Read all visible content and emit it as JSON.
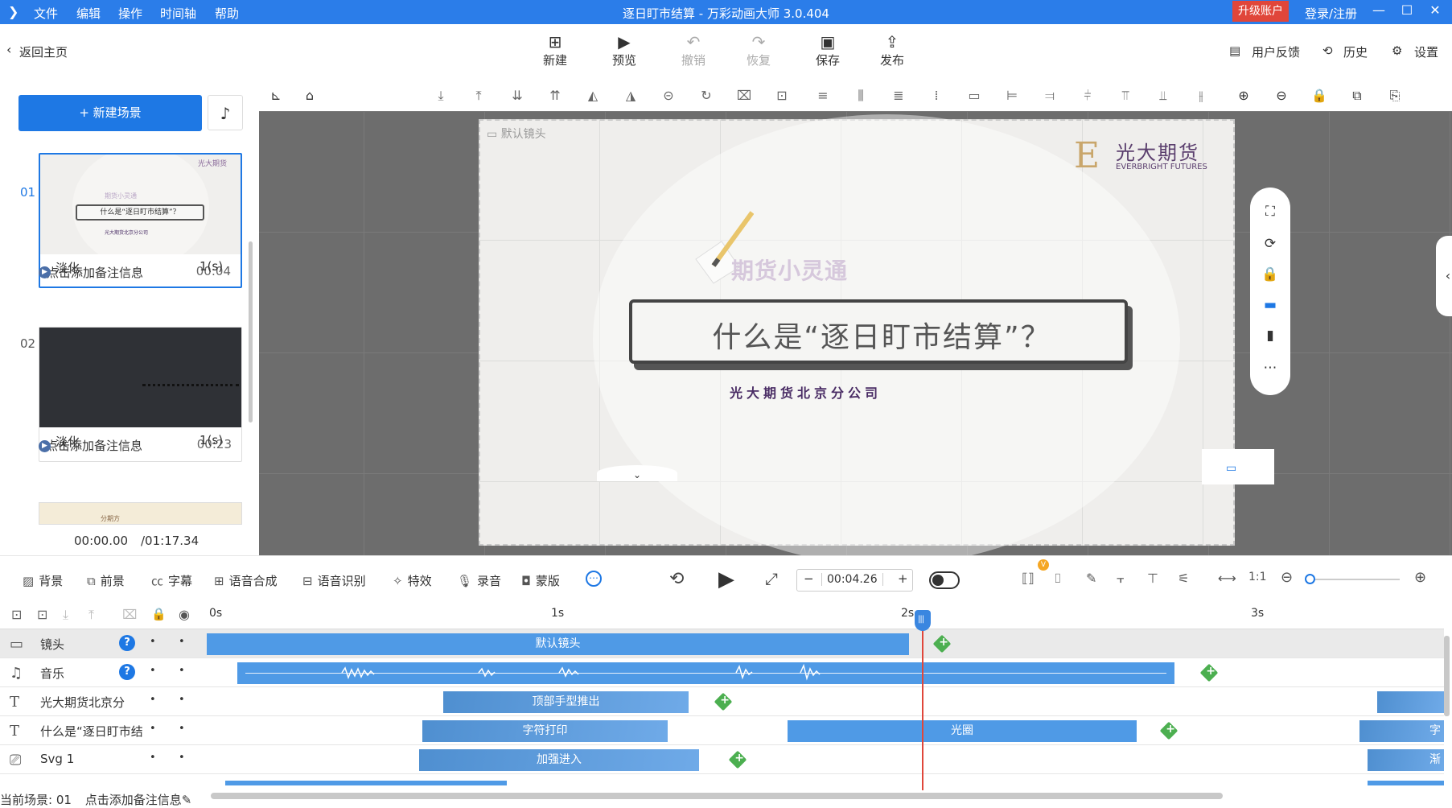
{
  "titlebar": {
    "menus": [
      "文件",
      "编辑",
      "操作",
      "时间轴",
      "帮助"
    ],
    "title": "逐日盯市结算 - 万彩动画大师 3.0.404",
    "upgrade": "升级账户",
    "login": "登录/注册",
    "accent": "#2b7de9"
  },
  "toolbar": {
    "back": "返回主页",
    "buttons": [
      {
        "label": "新建",
        "icon": "new-icon",
        "enabled": true
      },
      {
        "label": "预览",
        "icon": "play-icon",
        "enabled": true
      },
      {
        "label": "撤销",
        "icon": "undo-icon",
        "enabled": false
      },
      {
        "label": "恢复",
        "icon": "redo-icon",
        "enabled": false
      },
      {
        "label": "保存",
        "icon": "save-icon",
        "enabled": true
      },
      {
        "label": "发布",
        "icon": "publish-icon",
        "enabled": true
      }
    ],
    "feedback": "用户反馈",
    "history": "历史",
    "settings": "设置"
  },
  "left": {
    "new_scene": "新建场景",
    "scenes": [
      {
        "num": "01",
        "note": "点击添加备注信息",
        "duration": "00:04",
        "transition": "淡化",
        "trans_dur": "1(s)",
        "selected": true
      },
      {
        "num": "02",
        "note": "点击添加备注信息",
        "duration": "00:23",
        "transition": "淡化",
        "trans_dur": "1(s)",
        "selected": false
      }
    ],
    "thumb1": {
      "title": "什么是“逐日盯市结算”？",
      "sub": "期货小灵通"
    },
    "thumb3": {
      "text": "分期方"
    },
    "time_current": "00:00.00",
    "time_total": "/01:17.34"
  },
  "canvas": {
    "camera_label": "默认镜头",
    "brand_name": "光大期货",
    "brand_sub": "EVERBRIGHT FUTURES",
    "brand_mark": "E",
    "subtitle": "期货小灵通",
    "main_title": "什么是“逐日盯市结算”？",
    "company": "光大期货北京分公司"
  },
  "timeline_toolbar": {
    "items": [
      "背景",
      "前景",
      "字幕",
      "语音合成",
      "语音识别",
      "特效",
      "录音",
      "蒙版"
    ],
    "time": "00:04.26",
    "minus": "−",
    "plus": "+",
    "badge": "V"
  },
  "timeline": {
    "ticks": [
      "0s",
      "1s",
      "2s",
      "3s"
    ],
    "tracks": [
      {
        "name": "镜头",
        "icon": "camera-icon",
        "help": true
      },
      {
        "name": "音乐",
        "icon": "music-icon",
        "help": true
      },
      {
        "name": "光大期货北京分",
        "icon": "text-icon",
        "help": false
      },
      {
        "name": "什么是“逐日盯市结",
        "icon": "text-icon",
        "help": false
      },
      {
        "name": "Svg 1",
        "icon": "svg-icon",
        "help": false
      }
    ],
    "clips": {
      "camera": "默认镜头",
      "text1": "顶部手型推出",
      "text2a": "字符打印",
      "text2b": "光圈",
      "text2c": "字",
      "svg": "加强进入",
      "svg_c": "渐"
    },
    "playhead_seconds": 2.06
  },
  "status": {
    "scene": "当前场景: 01",
    "note": "点击添加备注信息"
  }
}
